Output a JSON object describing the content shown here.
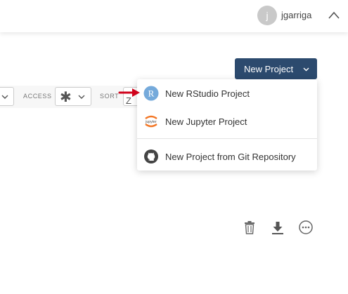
{
  "header": {
    "avatar_initial": "j",
    "username": "jgarriga",
    "collapse_icon": "chevron-up-icon"
  },
  "toolbar": {
    "new_project_label": "New Project"
  },
  "filters": {
    "access_label": "ACCESS",
    "access_value": "✱",
    "sort_label": "SORT",
    "sort_value": "Z"
  },
  "menu": {
    "items": [
      {
        "label": "New RStudio Project",
        "icon": "rstudio-icon",
        "icon_text": "R"
      },
      {
        "label": "New Jupyter Project",
        "icon": "jupyter-icon",
        "icon_text": "jupyter"
      },
      {
        "label": "New Project from Git Repository",
        "icon": "github-icon"
      }
    ]
  },
  "actions": {
    "icons": [
      "trash-icon",
      "download-icon",
      "more-options-icon"
    ]
  },
  "colors": {
    "primary_button": "#2c4a6e",
    "annotation_arrow": "#d0021b",
    "rstudio_blue": "#75aadb",
    "jupyter_orange": "#f37726"
  }
}
